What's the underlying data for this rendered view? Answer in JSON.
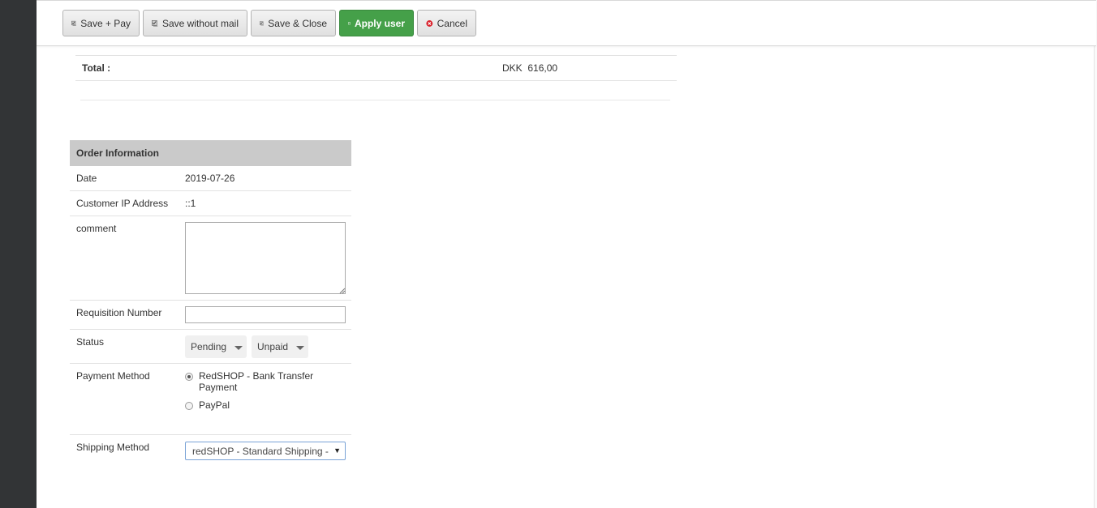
{
  "toolbar": {
    "save_pay": "Save + Pay",
    "save_without_mail": "Save without mail",
    "save_close": "Save & Close",
    "apply_user": "Apply user",
    "cancel": "Cancel"
  },
  "totals": {
    "label": "Total :",
    "value": "DKK  616,00"
  },
  "order_info": {
    "title": "Order Information",
    "date_label": "Date",
    "date_value": "2019-07-26",
    "ip_label": "Customer IP Address",
    "ip_value": "::1",
    "comment_label": "comment",
    "comment_value": "",
    "requisition_label": "Requisition Number",
    "requisition_value": "",
    "status_label": "Status",
    "status_order": "Pending",
    "status_payment": "Unpaid",
    "payment_label": "Payment Method",
    "payment_options": [
      {
        "label": "RedSHOP - Bank Transfer Payment",
        "checked": true
      },
      {
        "label": "PayPal",
        "checked": false
      }
    ],
    "shipping_label": "Shipping Method",
    "shipping_value": "redSHOP - Standard Shipping - D"
  },
  "icons": {
    "save": "save-icon",
    "apply": "floppy-icon",
    "cancel": "cancel-circle-icon"
  },
  "colors": {
    "apply_green": "#45a049",
    "cancel_red": "#d9232d",
    "header_gray": "#cacaca",
    "sidebar_dark": "#323436"
  }
}
